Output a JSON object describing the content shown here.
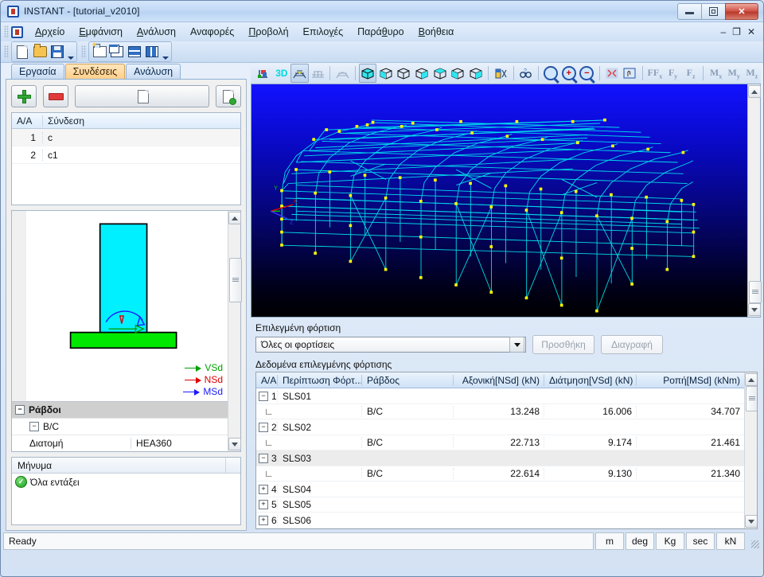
{
  "window": {
    "title": "INSTANT - [tutorial_v2010]",
    "minimize": "–",
    "maximize": "□",
    "close": "✕"
  },
  "menu": {
    "items": [
      {
        "label": "Αρχείο",
        "accel": "Α"
      },
      {
        "label": "Εμφάνιση",
        "accel": "Ε"
      },
      {
        "label": "Ανάλυση",
        "accel": "Α"
      },
      {
        "label": "Αναφορές",
        "accel": ""
      },
      {
        "label": "Προβολή",
        "accel": "Π"
      },
      {
        "label": "Επιλογές",
        "accel": "γ"
      },
      {
        "label": "Παράθυρο",
        "accel": "θ"
      },
      {
        "label": "Βοήθεια",
        "accel": "Β"
      }
    ],
    "mdi_minimize": "–",
    "mdi_restore": "❐",
    "mdi_close": "✕"
  },
  "toolbar": {
    "group1": [
      "new-document-icon",
      "open-folder-icon",
      "save-disk-icon"
    ],
    "group2": [
      "new-project-icon",
      "cascade-windows-icon",
      "tile-horizontal-icon",
      "tile-vertical-icon"
    ]
  },
  "tabs": [
    {
      "label": "Εργασία",
      "active": false
    },
    {
      "label": "Συνδέσεις",
      "active": true
    },
    {
      "label": "Ανάλυση",
      "active": false
    }
  ],
  "connections": {
    "add_button": "add-connection-button",
    "remove_button": "remove-connection-button",
    "copy_button": "copy-connection-button",
    "paste_button": "paste-connection-button",
    "headers": [
      "A/A",
      "Σύνδεση"
    ],
    "rows": [
      {
        "num": "1",
        "name": "c"
      },
      {
        "num": "2",
        "name": "c1"
      }
    ]
  },
  "detail": {
    "legend": [
      {
        "label": "VSd",
        "color": "#00a000"
      },
      {
        "label": "NSd",
        "color": "#e00000"
      },
      {
        "label": "MSd",
        "color": "#1a1aff"
      }
    ],
    "properties": {
      "group": "Ράβδοι",
      "subgroup": "B/C",
      "rows": [
        {
          "key": "Διατομή",
          "value": "HEA360"
        }
      ]
    }
  },
  "messages": {
    "header": "Μήνυμα",
    "items": [
      {
        "text": "Όλα εντάξει",
        "status": "ok"
      }
    ]
  },
  "viewport_toolbar": {
    "icons": [
      "axes-icon",
      "3d-icon",
      "render-frame-icon",
      "render-mesh-icon",
      "render-wire-icon",
      "view-iso-icon",
      "view-front-icon",
      "view-back-icon",
      "view-left-icon",
      "view-right-icon",
      "view-top-icon",
      "view-bottom-icon",
      "cut-section-icon",
      "find-icon",
      "zoom-window-icon",
      "zoom-in-icon",
      "zoom-out-icon",
      "zoom-extents-icon",
      "pan-icon"
    ],
    "force_labels": [
      "Fx",
      "Fy",
      "Fz"
    ],
    "moment_labels": [
      "Mx",
      "My",
      "Mz"
    ]
  },
  "loads": {
    "selected_label": "Επιλεγμένη φόρτιση",
    "selected_value": "Όλες οι φορτίσεις",
    "add_button": "Προσθήκη",
    "delete_button": "Διαγραφή",
    "data_label": "Δεδομένα επιλεγμένης φόρτισης",
    "headers": [
      "A/A",
      "Περίπτωση Φόρτ...",
      "Ράβδος",
      "Αξονική[NSd] (kN)",
      "Διάτμηση[VSd] (kN)",
      "Ροπή[MSd] (kNm)"
    ],
    "rows": [
      {
        "type": "group",
        "expander": "−",
        "num": "1",
        "case": "SLS01",
        "bar": "",
        "n": "",
        "v": "",
        "m": "",
        "selected": false
      },
      {
        "type": "child",
        "expander": "",
        "num": "",
        "case": "",
        "bar": "B/C",
        "n": "13.248",
        "v": "16.006",
        "m": "34.707",
        "selected": false
      },
      {
        "type": "group",
        "expander": "−",
        "num": "2",
        "case": "SLS02",
        "bar": "",
        "n": "",
        "v": "",
        "m": "",
        "selected": false
      },
      {
        "type": "child",
        "expander": "",
        "num": "",
        "case": "",
        "bar": "B/C",
        "n": "22.713",
        "v": "9.174",
        "m": "21.461",
        "selected": false
      },
      {
        "type": "group",
        "expander": "−",
        "num": "3",
        "case": "SLS03",
        "bar": "",
        "n": "",
        "v": "",
        "m": "",
        "selected": true
      },
      {
        "type": "child",
        "expander": "",
        "num": "",
        "case": "",
        "bar": "B/C",
        "n": "22.614",
        "v": "9.130",
        "m": "21.340",
        "selected": false
      },
      {
        "type": "group",
        "expander": "+",
        "num": "4",
        "case": "SLS04",
        "bar": "",
        "n": "",
        "v": "",
        "m": "",
        "selected": false
      },
      {
        "type": "group",
        "expander": "+",
        "num": "5",
        "case": "SLS05",
        "bar": "",
        "n": "",
        "v": "",
        "m": "",
        "selected": false
      },
      {
        "type": "group",
        "expander": "+",
        "num": "6",
        "case": "SLS06",
        "bar": "",
        "n": "",
        "v": "",
        "m": "",
        "selected": false
      }
    ]
  },
  "statusbar": {
    "message": "Ready",
    "units": [
      "m",
      "deg",
      "Kg",
      "sec",
      "kN"
    ]
  },
  "colors": {
    "accent": "#2f6fc4",
    "tab_active": "#ffcf8c",
    "ok_green": "#18a018",
    "model_member": "#00e5ee",
    "model_node": "#ffff00",
    "viewport_bg_top": "#1212ff",
    "viewport_bg_bottom": "#000000"
  }
}
